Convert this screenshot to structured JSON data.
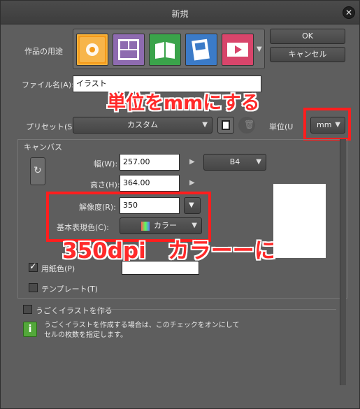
{
  "window": {
    "title": "新規"
  },
  "purpose": {
    "label": "作品の用途",
    "items": [
      "illustration",
      "comic",
      "book",
      "webtoon",
      "animation"
    ]
  },
  "buttons": {
    "ok": "OK",
    "cancel": "キャンセル"
  },
  "file": {
    "label": "ファイル名(A):",
    "value": "イラスト"
  },
  "preset": {
    "label": "プリセット(S):",
    "value": "カスタム"
  },
  "unit": {
    "label": "単位(U",
    "value": "mm"
  },
  "canvas": {
    "section_label": "キャンバス",
    "width_label": "幅(W):",
    "width_value": "257.00",
    "height_label": "高さ(H):",
    "height_value": "364.00",
    "size_preset": "B4",
    "resolution_label": "解像度(R):",
    "resolution_value": "350",
    "color_label": "基本表現色(C):",
    "color_value": "カラー",
    "paper_color_label": "用紙色(P)",
    "template_label": "テンプレート(T)"
  },
  "animation": {
    "label": "うごくイラストを作る",
    "info": "うごくイラストを作成する場合は、このチェックをオンにして",
    "info2": "セルの枚数を指定します。"
  },
  "annotations": {
    "unit_note": "単位をmmにする",
    "dpi_note": "350dpi　カラーーに"
  },
  "colors": {
    "annotation_red": "#ff1e1e",
    "accent_orange": "#f49a1a",
    "info_green": "#53a83a"
  }
}
